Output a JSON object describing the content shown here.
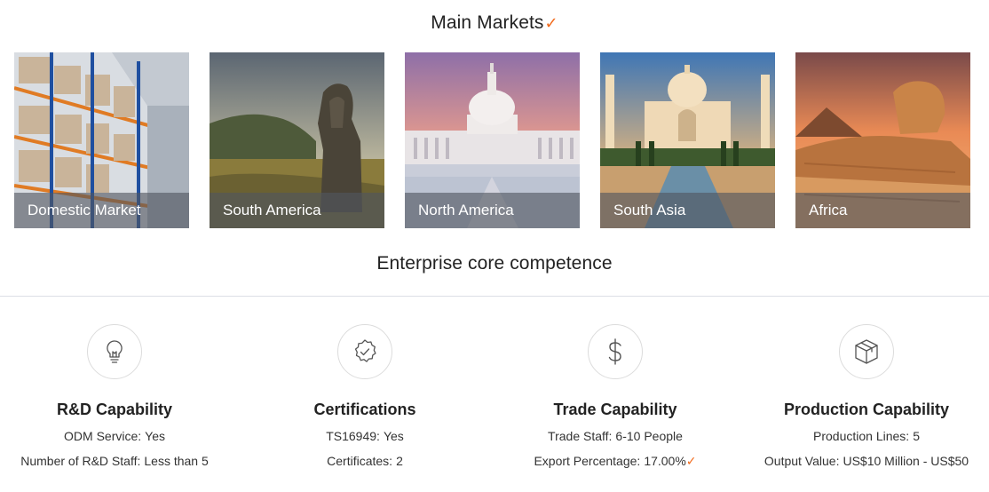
{
  "main_markets": {
    "title": "Main Markets",
    "check_icon": "check-icon",
    "accent": "#f26a1b",
    "items": [
      {
        "label": "Domestic Market"
      },
      {
        "label": "South America"
      },
      {
        "label": "North America"
      },
      {
        "label": "South Asia"
      },
      {
        "label": "Africa"
      }
    ]
  },
  "core": {
    "title": "Enterprise core competence",
    "items": [
      {
        "icon": "lightbulb-icon",
        "title": "R&D Capability",
        "rows": [
          {
            "label": "ODM Service:",
            "value": "Yes"
          },
          {
            "label": "Number of R&D Staff:",
            "value": "Less than 5"
          }
        ]
      },
      {
        "icon": "certificate-badge-icon",
        "title": "Certifications",
        "rows": [
          {
            "label": "TS16949:",
            "value": "Yes"
          },
          {
            "label": "Certificates:",
            "value": "2"
          }
        ]
      },
      {
        "icon": "dollar-icon",
        "title": "Trade Capability",
        "rows": [
          {
            "label": "Trade Staff:",
            "value": "6-10 People"
          },
          {
            "label": "Export Percentage:",
            "value": "17.00%"
          }
        ]
      },
      {
        "icon": "box-icon",
        "title": "Production Capability",
        "rows": [
          {
            "label": "Production Lines:",
            "value": "5"
          },
          {
            "label": "Output Value:",
            "value": "US$10 Million - US$50"
          }
        ]
      }
    ]
  }
}
